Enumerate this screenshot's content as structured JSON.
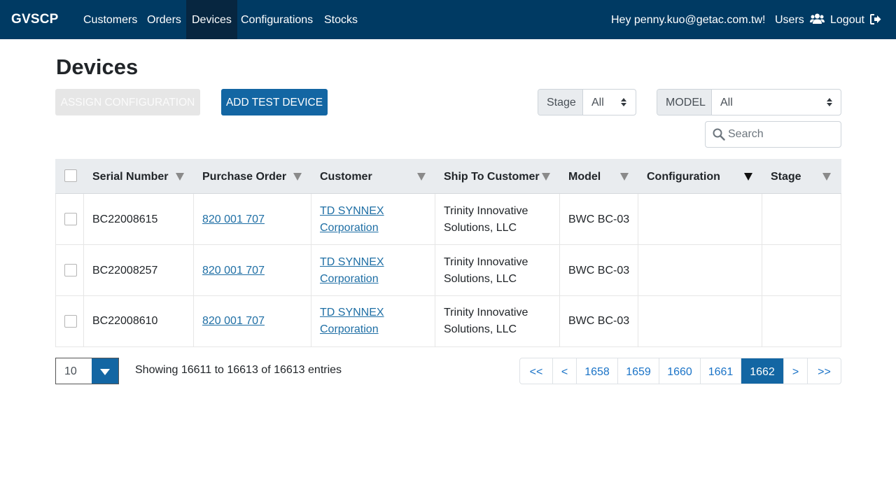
{
  "nav": {
    "brand": "GVSCP",
    "items": [
      "Customers",
      "Orders",
      "Devices",
      "Configurations",
      "Stocks"
    ],
    "greeting": "Hey penny.kuo@getac.com.tw!",
    "users": "Users",
    "logout": "Logout"
  },
  "page": {
    "title": "Devices",
    "assign_label": "ASSIGN CONFIGURATION",
    "add_label": "ADD TEST DEVICE"
  },
  "filters": {
    "stage_label": "Stage",
    "stage_value": "All",
    "model_label": "MODEL",
    "model_value": "All",
    "search_placeholder": "Search"
  },
  "table": {
    "columns": [
      "Serial Number",
      "Purchase Order",
      "Customer",
      "Ship To Customer",
      "Model",
      "Configuration",
      "Stage"
    ],
    "rows": [
      {
        "serial": "BC22008615",
        "po": "820 001 707",
        "customer1": "TD SYNNEX",
        "customer2": "Corporation",
        "ship1": "Trinity Innovative",
        "ship2": "Solutions, LLC",
        "model": "BWC BC-03",
        "config": "",
        "stage": ""
      },
      {
        "serial": "BC22008257",
        "po": "820 001 707",
        "customer1": "TD SYNNEX",
        "customer2": "Corporation",
        "ship1": "Trinity Innovative",
        "ship2": "Solutions, LLC",
        "model": "BWC BC-03",
        "config": "",
        "stage": ""
      },
      {
        "serial": "BC22008610",
        "po": "820 001 707",
        "customer1": "TD SYNNEX",
        "customer2": "Corporation",
        "ship1": "Trinity Innovative",
        "ship2": "Solutions, LLC",
        "model": "BWC BC-03",
        "config": "",
        "stage": ""
      }
    ]
  },
  "footer": {
    "page_length": "10",
    "info": "Showing 16611 to 16613 of 16613 entries",
    "pages": [
      "<<",
      "<",
      "1658",
      "1659",
      "1660",
      "1661",
      "1662",
      ">",
      ">>"
    ],
    "active_page": "1662"
  },
  "colors": {
    "navbar": "#003a63",
    "nav_active": "#072640",
    "primary": "#1366a3",
    "link": "#1f6fa5"
  }
}
